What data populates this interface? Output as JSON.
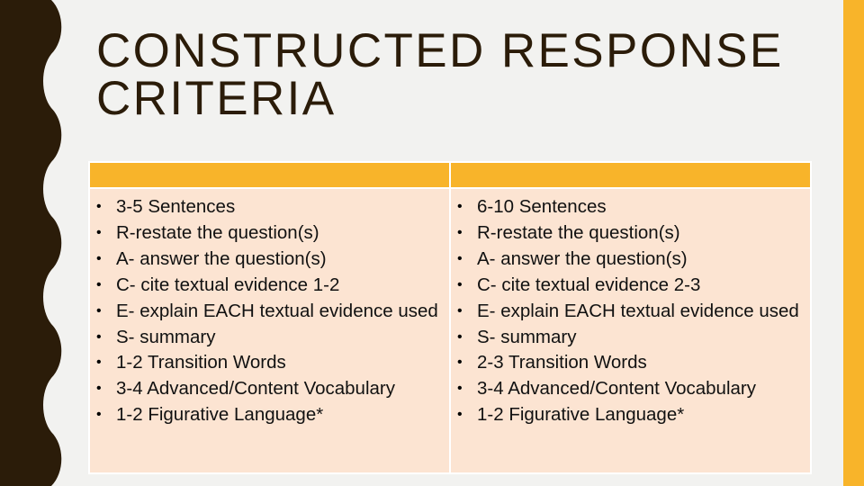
{
  "slide": {
    "title": "CONSTRUCTED RESPONSE CRITERIA",
    "colors": {
      "background": "#f2f2f0",
      "left_band": "#2b1c09",
      "accent": "#f8b42a",
      "table_body": "#fce4d2",
      "title_text": "#2b1c09"
    }
  },
  "table": {
    "headers": [
      "",
      ""
    ],
    "columns": [
      {
        "items": [
          "3-5 Sentences",
          "R-restate the question(s)",
          "A- answer the question(s)",
          "C- cite textual evidence 1-2",
          "E- explain EACH textual evidence used",
          "S- summary",
          "1-2 Transition Words",
          "3-4 Advanced/Content Vocabulary",
          "1-2 Figurative Language*"
        ]
      },
      {
        "items": [
          "6-10 Sentences",
          "R-restate the question(s)",
          "A- answer the question(s)",
          "C- cite textual evidence 2-3",
          "E- explain EACH textual evidence used",
          "S- summary",
          "2-3 Transition Words",
          "3-4 Advanced/Content Vocabulary",
          "1-2 Figurative Language*"
        ]
      }
    ],
    "bullet_glyph": "•"
  }
}
